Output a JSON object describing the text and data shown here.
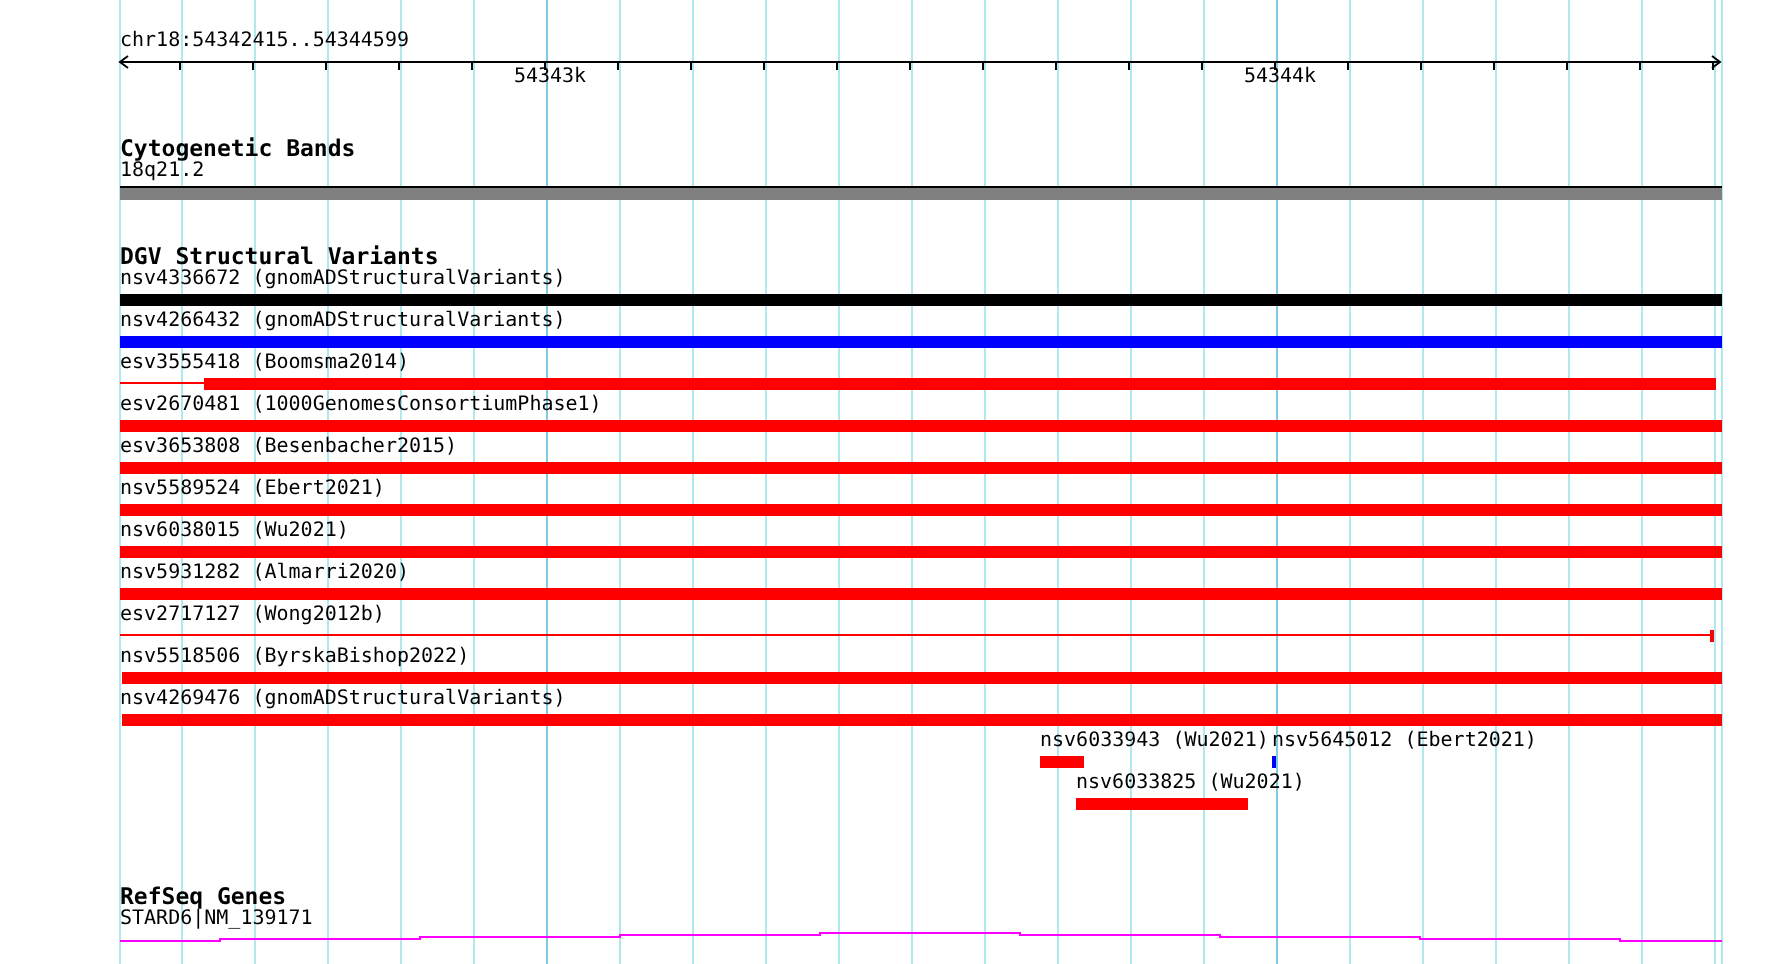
{
  "ruler": {
    "range": "chr18:54342415..54344599",
    "tick_labels": [
      "54343k",
      "54344k"
    ]
  },
  "cytogenetic_bands": {
    "title": "Cytogenetic Bands",
    "features": [
      {
        "label": "18q21.2",
        "color": "#808080"
      }
    ]
  },
  "dgv_structural_variants": {
    "title": "DGV Structural Variants",
    "features": [
      {
        "label": "nsv4336672 (gnomADStructuralVariants)",
        "color": "#000000",
        "kind": "thick"
      },
      {
        "label": "nsv4266432 (gnomADStructuralVariants)",
        "color": "#0000ff",
        "kind": "thick"
      },
      {
        "label": "esv3555418 (Boomsma2014)",
        "color": "#ff0000",
        "kind": "lead"
      },
      {
        "label": "esv2670481 (1000GenomesConsortiumPhase1)",
        "color": "#ff0000",
        "kind": "thick"
      },
      {
        "label": "esv3653808 (Besenbacher2015)",
        "color": "#ff0000",
        "kind": "thick"
      },
      {
        "label": "nsv5589524 (Ebert2021)",
        "color": "#ff0000",
        "kind": "thick"
      },
      {
        "label": "nsv6038015 (Wu2021)",
        "color": "#ff0000",
        "kind": "thick"
      },
      {
        "label": "nsv5931282 (Almarri2020)",
        "color": "#ff0000",
        "kind": "thick"
      },
      {
        "label": "esv2717127 (Wong2012b)",
        "color": "#ff0000",
        "kind": "thin"
      },
      {
        "label": "nsv5518506 (ByrskaBishop2022)",
        "color": "#ff0000",
        "kind": "thick"
      },
      {
        "label": "nsv4269476 (gnomADStructuralVariants)",
        "color": "#ff0000",
        "kind": "thick"
      }
    ],
    "packed_features": [
      {
        "label": "nsv6033943 (Wu2021)",
        "color": "#ff0000"
      },
      {
        "label": "nsv5645012 (Ebert2021)",
        "color": "#0000ff"
      },
      {
        "label": "nsv6033825 (Wu2021)",
        "color": "#ff0000"
      }
    ]
  },
  "refseq_genes": {
    "title": "RefSeq Genes",
    "features": [
      {
        "label": "STARD6|NM_139171",
        "color": "#ff00ff"
      }
    ]
  }
}
